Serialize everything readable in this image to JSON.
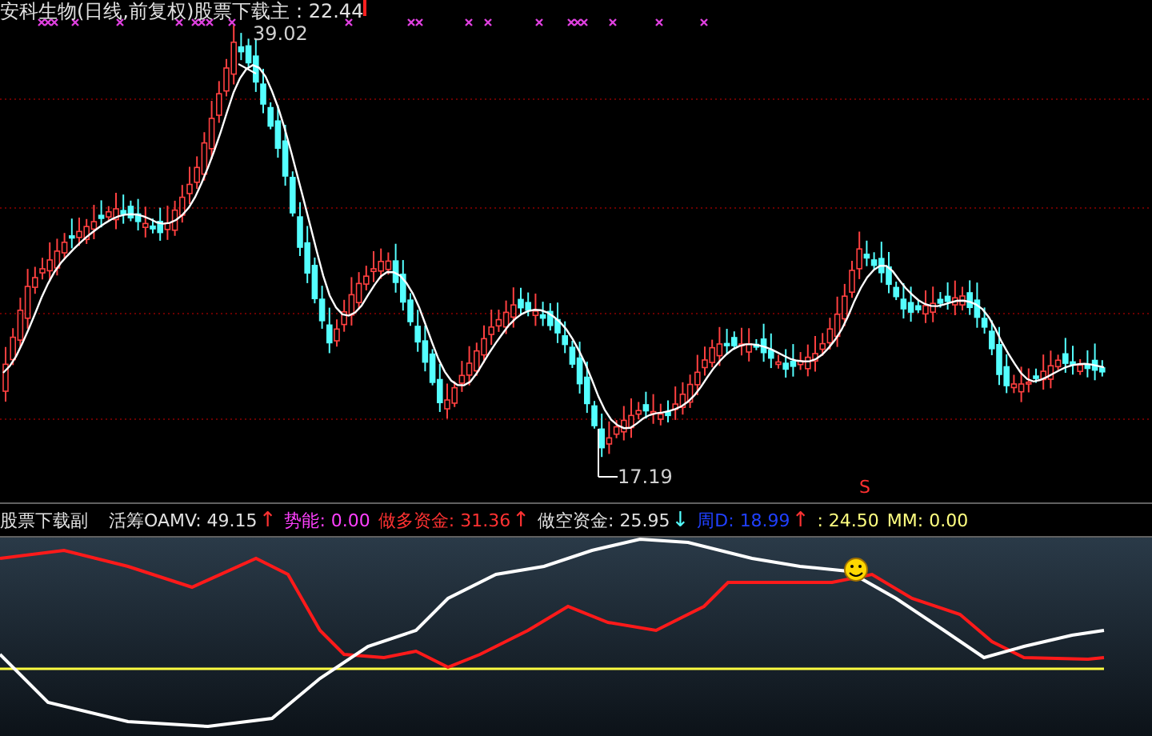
{
  "main_chart": {
    "title": "安科生物(日线,前复权)股票下载主 : 22.44",
    "high_label": "39.02",
    "low_label": "17.19"
  },
  "indicator_bar": {
    "name": "股票下载副",
    "items": [
      {
        "kind": "value",
        "label": "活筹OAMV: 49.15",
        "color": "#e0e0e0"
      },
      {
        "kind": "arrow",
        "label": "↑",
        "color": "#ff3232"
      },
      {
        "kind": "value",
        "label": "势能: 0.00",
        "color": "#ff40ff"
      },
      {
        "kind": "value",
        "label": "做多资金: 31.36",
        "color": "#ff3232"
      },
      {
        "kind": "arrow",
        "label": "↑",
        "color": "#ff3232"
      },
      {
        "kind": "value",
        "label": "做空资金: 25.95",
        "color": "#e0e0e0"
      },
      {
        "kind": "arrow",
        "label": "↓",
        "color": "#54ffff"
      },
      {
        "kind": "value",
        "label": "周D: 18.99",
        "color": "#2040ff"
      },
      {
        "kind": "arrow",
        "label": "↑",
        "color": "#ff3232"
      },
      {
        "kind": "value",
        "label": ": 24.50",
        "color": "#ffff80"
      },
      {
        "kind": "value",
        "label": "MM: 0.00",
        "color": "#ffff80"
      }
    ]
  },
  "signal_mark": "S"
}
